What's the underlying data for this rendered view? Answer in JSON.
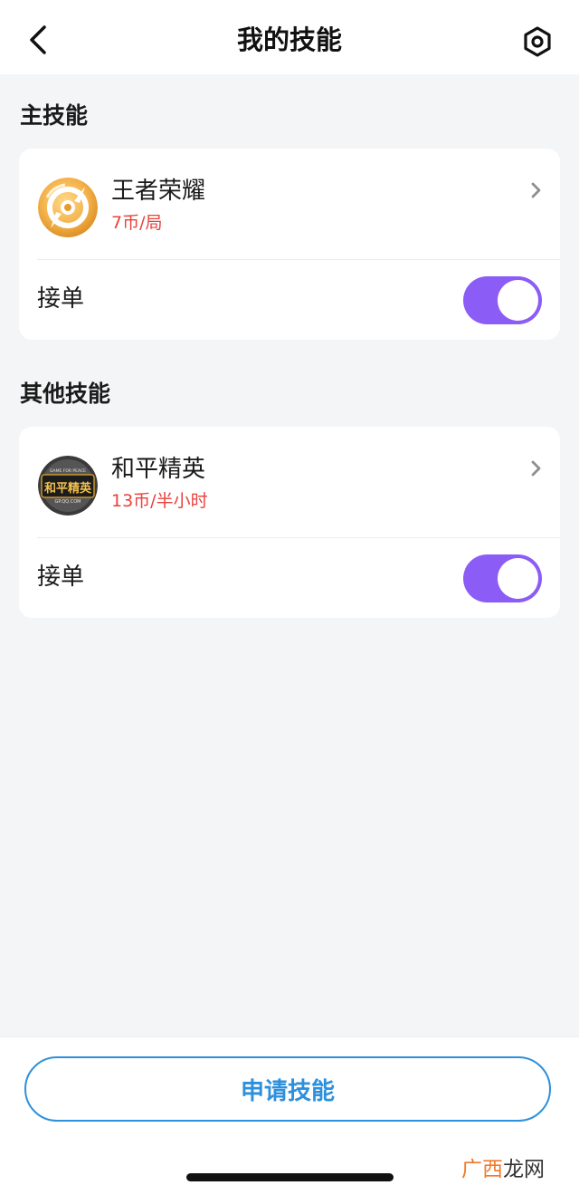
{
  "header": {
    "title": "我的技能"
  },
  "sections": [
    {
      "title": "主技能",
      "skill": {
        "name": "王者荣耀",
        "price": "7币/局",
        "icon": "honor-of-kings-logo",
        "order_label": "接单",
        "order_enabled": true
      }
    },
    {
      "title": "其他技能",
      "skill": {
        "name": "和平精英",
        "price": "13币/半小时",
        "icon": "game-for-peace-logo",
        "icon_text": "和平精英",
        "icon_subtext_top": "GAME FOR PEACE",
        "icon_subtext_bottom": "GP.QQ.COM",
        "order_label": "接单",
        "order_enabled": true
      }
    }
  ],
  "footer": {
    "apply_label": "申请技能"
  },
  "watermark": {
    "accent": "广西",
    "rest": "龙网"
  },
  "colors": {
    "toggle_on": "#8b5cf6",
    "price": "#e8413c",
    "primary": "#2d90dc",
    "background": "#f4f5f7"
  }
}
